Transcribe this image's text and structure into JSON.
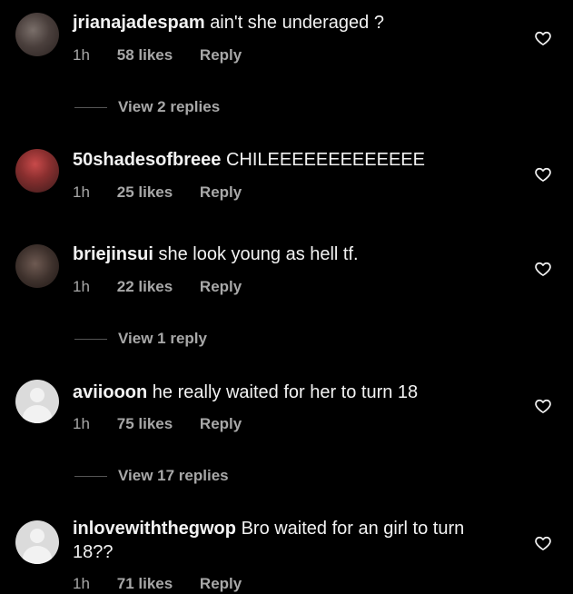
{
  "comments": [
    {
      "username": "jrianajadespam",
      "text": "ain't she underaged ?",
      "time": "1h",
      "likes": "58 likes",
      "reply": "Reply",
      "view_replies": "View 2 replies",
      "avatar": "profile-photo"
    },
    {
      "username": "50shadesofbreee",
      "text": "CHILEEEEEEEEEEEEE",
      "time": "1h",
      "likes": "25 likes",
      "reply": "Reply",
      "avatar": "profile-photo"
    },
    {
      "username": "briejinsui",
      "text": "she look young as hell tf.",
      "time": "1h",
      "likes": "22 likes",
      "reply": "Reply",
      "view_replies": "View 1 reply",
      "avatar": "profile-photo"
    },
    {
      "username": "aviiooon",
      "text": "he really waited for her to turn 18",
      "time": "1h",
      "likes": "75 likes",
      "reply": "Reply",
      "view_replies": "View 17 replies",
      "avatar": "default-avatar"
    },
    {
      "username": "inlovewiththegwop",
      "text": "Bro waited for an girl to turn 18??",
      "time": "1h",
      "likes": "71 likes",
      "reply": "Reply",
      "avatar": "default-avatar"
    }
  ],
  "icons": {
    "like": "heart-outline-icon"
  },
  "colors": {
    "background": "#000000",
    "primary_text": "#f2f2f2",
    "secondary_text": "#a8a8a8"
  }
}
